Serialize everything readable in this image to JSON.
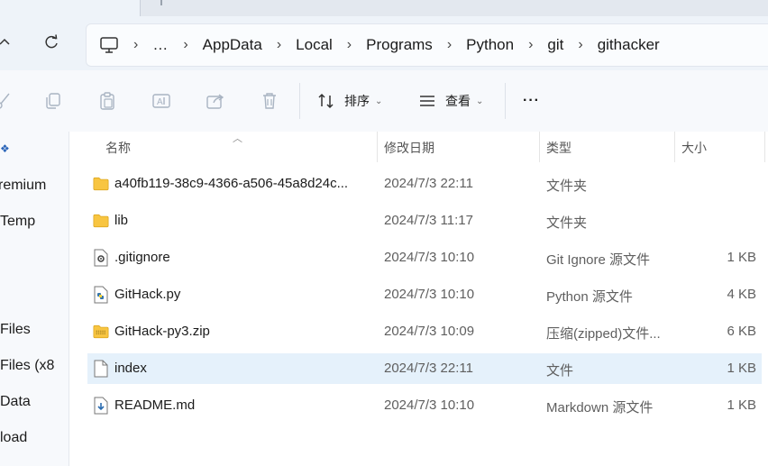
{
  "breadcrumb": [
    "AppData",
    "Local",
    "Programs",
    "Python",
    "git",
    "githacker"
  ],
  "overflow_dots": "…",
  "toolbar": {
    "sort_label": "排序",
    "view_label": "查看",
    "more_label": "···"
  },
  "sidebar": {
    "items": [
      "remium",
      "Temp",
      "Files",
      "Files (x8",
      "Data",
      "load"
    ]
  },
  "columns": {
    "name": "名称",
    "modified": "修改日期",
    "type": "类型",
    "size": "大小"
  },
  "files": [
    {
      "name": "a40fb119-38c9-4366-a506-45a8d24c...",
      "modified": "2024/7/3 22:11",
      "type": "文件夹",
      "size": "",
      "icon": "folder-icon"
    },
    {
      "name": "lib",
      "modified": "2024/7/3 11:17",
      "type": "文件夹",
      "size": "",
      "icon": "folder-icon"
    },
    {
      "name": ".gitignore",
      "modified": "2024/7/3 10:10",
      "type": "Git Ignore 源文件",
      "size": "1 KB",
      "icon": "gear-file-icon"
    },
    {
      "name": "GitHack.py",
      "modified": "2024/7/3 10:10",
      "type": "Python 源文件",
      "size": "4 KB",
      "icon": "python-file-icon"
    },
    {
      "name": "GitHack-py3.zip",
      "modified": "2024/7/3 10:09",
      "type": "压缩(zipped)文件...",
      "size": "6 KB",
      "icon": "zip-folder-icon"
    },
    {
      "name": "index",
      "modified": "2024/7/3 22:11",
      "type": "文件",
      "size": "1 KB",
      "icon": "blank-file-icon",
      "selected": true
    },
    {
      "name": "README.md",
      "modified": "2024/7/3 10:10",
      "type": "Markdown 源文件",
      "size": "1 KB",
      "icon": "markdown-file-icon"
    }
  ],
  "colors": {
    "accent": "#0067c0",
    "selection": "#e5f1fb",
    "folder": "#f8c541"
  }
}
